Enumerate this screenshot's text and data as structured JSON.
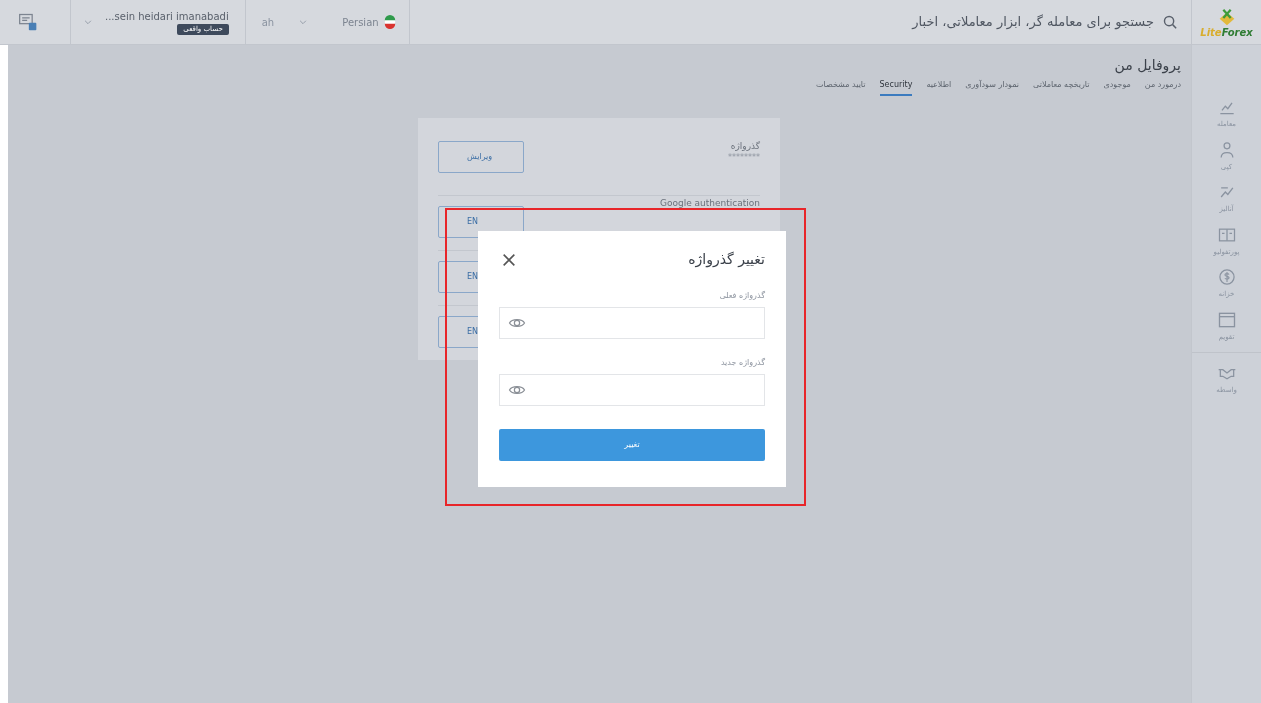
{
  "topbar": {
    "search_placeholder": "جستجو برای معامله گر، ابزار معاملاتی، اخبار",
    "user_name": "...sein heidari imanabadi",
    "account_badge": "حساب واقعی",
    "short_label": "ah",
    "language": "Persian"
  },
  "logo": {
    "text_a": "Lite",
    "text_b": "Forex"
  },
  "sidebar": {
    "items": [
      {
        "label": "معامله"
      },
      {
        "label": "کپی"
      },
      {
        "label": "آنالیز"
      },
      {
        "label": "پورتفولیو"
      },
      {
        "label": "خزانه"
      },
      {
        "label": "تقویم"
      },
      {
        "label": "واسطه"
      }
    ]
  },
  "page": {
    "title": "پروفایل من",
    "tabs": [
      {
        "label": "درمورد من",
        "selected": false
      },
      {
        "label": "موجودی",
        "selected": false
      },
      {
        "label": "تاریخچه معاملاتی",
        "selected": false
      },
      {
        "label": "نمودار سودآوری",
        "selected": false
      },
      {
        "label": "اطلاعیه",
        "selected": false
      },
      {
        "label": "Security",
        "selected": true
      },
      {
        "label": "تایید مشخصات",
        "selected": false
      }
    ]
  },
  "security_rows": [
    {
      "label": "گذرواژه",
      "value": "********",
      "button": "ویرایش"
    },
    {
      "label": "Google authentication",
      "button": "EN"
    },
    {
      "button": "EN"
    },
    {
      "button": "EN"
    }
  ],
  "dialog": {
    "title": "تغییر گذرواژه",
    "fields": [
      {
        "label": "گذرواژه فعلی"
      },
      {
        "label": "گذرواژه جدید"
      }
    ],
    "submit": "تغییر"
  }
}
